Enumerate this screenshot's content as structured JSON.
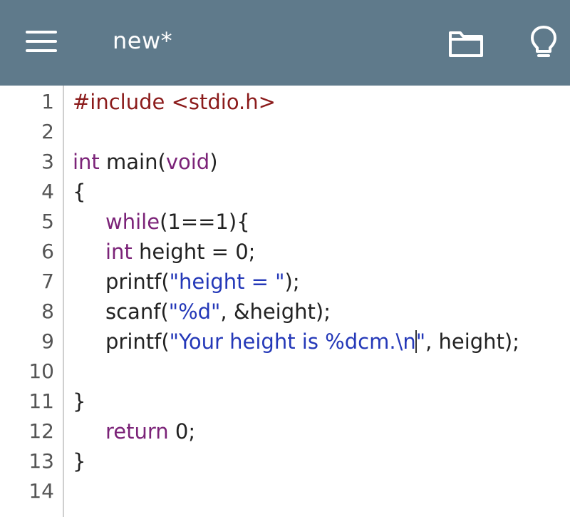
{
  "app_bar": {
    "title": "new*",
    "menu_icon": "hamburger-menu-icon",
    "folder_icon": "folder-icon",
    "bulb_icon": "lightbulb-icon",
    "background": "#5f7a8b"
  },
  "editor": {
    "line_numbers": [
      "1",
      "2",
      "3",
      "4",
      "5",
      "6",
      "7",
      "8",
      "9",
      "10",
      "11",
      "12",
      "13",
      "14"
    ],
    "lines": {
      "l1": {
        "directive": "#include <stdio.h>"
      },
      "l3": {
        "type": "int",
        "rest": " main(",
        "param": "void",
        "close": ")"
      },
      "l4": {
        "text": "{"
      },
      "l5": {
        "kw": "while",
        "rest": "(1==1){"
      },
      "l6": {
        "type": "int",
        "rest": " height = 0;"
      },
      "l7": {
        "fn": "printf(",
        "str": "\"height = \"",
        "rest": ");"
      },
      "l8": {
        "fn": "scanf(",
        "str": "\"%d\"",
        "rest": ", &height);"
      },
      "l9": {
        "fn": "printf(",
        "str_a": "\"Your height is %dcm.\\n",
        "str_b": "\"",
        "rest": ", height);"
      },
      "l11": {
        "text": "}"
      },
      "l12": {
        "kw": "return",
        "rest": " 0;"
      },
      "l13": {
        "text": "}"
      }
    },
    "colors": {
      "preprocessor": "#8b1b1b",
      "keyword": "#7b2378",
      "string": "#2438b8",
      "text": "#222222"
    }
  }
}
